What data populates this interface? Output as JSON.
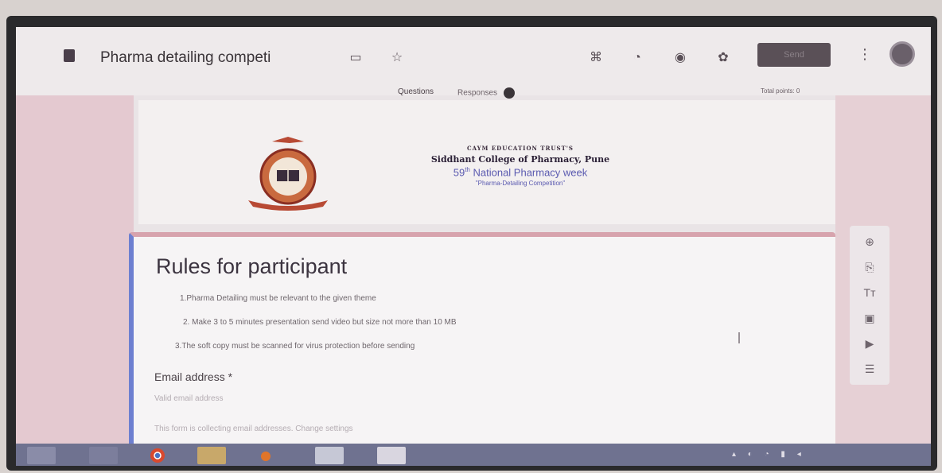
{
  "app": {
    "form_title": "Pharma detailing competi",
    "tabs": [
      "Questions",
      "Responses"
    ],
    "total_points": "Total points: 0",
    "send_label": "Send"
  },
  "header": {
    "trust": "CAYM EDUCATION TRUST'S",
    "college": "Siddhant College of Pharmacy, Pune",
    "week_number": "59",
    "week_suffix": "th",
    "week_text": "National Pharmacy week",
    "competition": "\"Pharma-Detailing Competition\""
  },
  "form": {
    "title": "Rules for participant",
    "rules": [
      "1.Pharma Detailing must be relevant to the given theme",
      "2. Make 3 to 5 minutes presentation send video but size not more than 10 MB",
      "3.The soft copy must be scanned for virus protection before sending"
    ],
    "email_label": "Email address *",
    "email_placeholder": "Valid email address",
    "collect_note": "This form is collecting email addresses.  Change settings"
  },
  "colors": {
    "accent_left": "#6d7fd0",
    "accent_top": "#d7a3ad",
    "banner_blue": "#5a5ab0",
    "taskbar": "#6f7290"
  }
}
